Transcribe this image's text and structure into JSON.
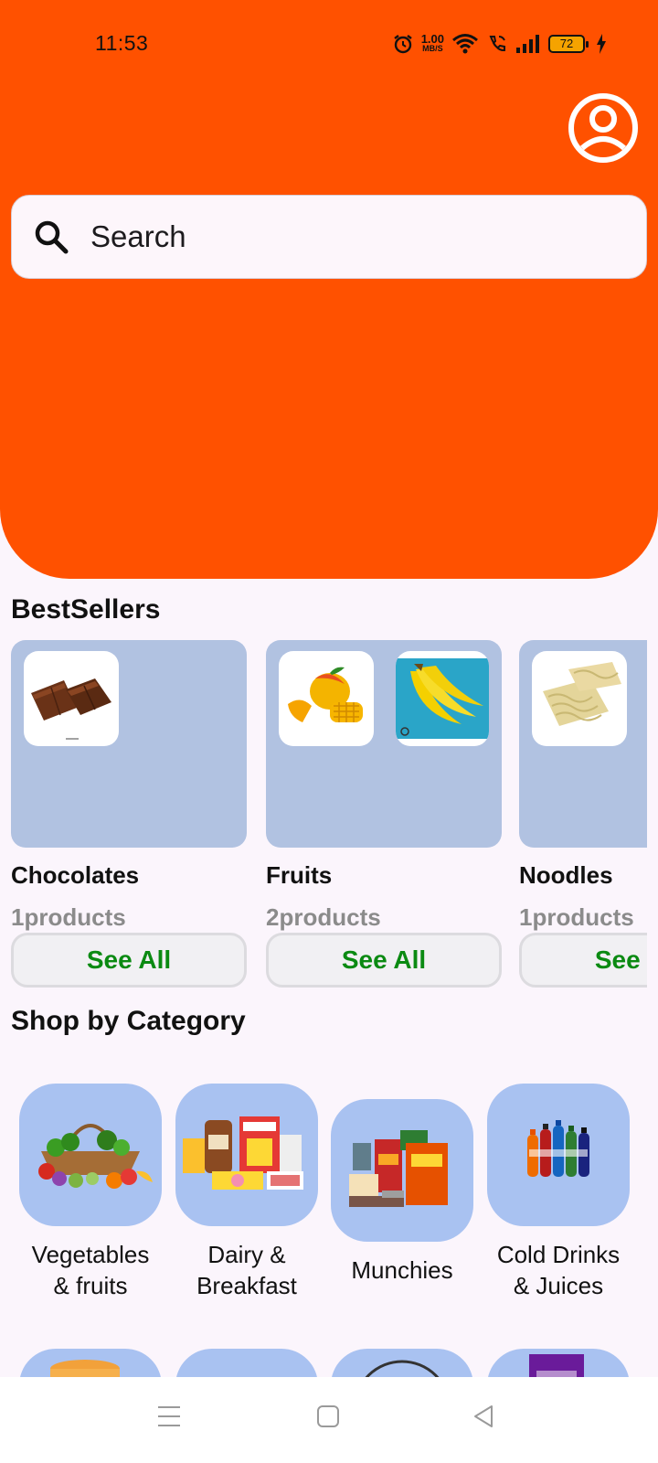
{
  "status_bar": {
    "time": "11:53",
    "net_speed_value": "1.00",
    "net_speed_unit": "MB/S",
    "battery_level": "72",
    "icons": [
      "alarm-icon",
      "wifi-icon",
      "wifi-call-icon",
      "signal-icon",
      "battery-icon",
      "charging-icon"
    ]
  },
  "header": {
    "background_color": "#ff5100",
    "profile_icon": "account-circle-icon"
  },
  "search": {
    "placeholder": "Search",
    "icon": "search-icon"
  },
  "bestsellers": {
    "title": "BestSellers",
    "items": [
      {
        "name": "Chocolates",
        "count": "1products",
        "button": "See All",
        "images": [
          "chocolate-image"
        ]
      },
      {
        "name": "Fruits",
        "count": "2products",
        "button": "See All",
        "images": [
          "mango-image",
          "banana-image"
        ]
      },
      {
        "name": "Noodles",
        "count": "1products",
        "button": "See All",
        "images": [
          "noodles-image"
        ]
      }
    ]
  },
  "categories": {
    "title": "Shop by Category",
    "items": [
      {
        "line1": "Vegetables",
        "line2": "& fruits",
        "image": "vegetables-basket-image"
      },
      {
        "line1": "Dairy &",
        "line2": "Breakfast",
        "image": "dairy-breakfast-image"
      },
      {
        "line1": "Munchies",
        "line2": "",
        "image": "munchies-image"
      },
      {
        "line1": "Cold Drinks",
        "line2": "& Juices",
        "image": "cold-drinks-image"
      }
    ]
  },
  "colors": {
    "accent": "#ff5100",
    "card": "#b1c2e1",
    "category_tile": "#a9c2f1",
    "see_all_text": "#0b8a12"
  },
  "nav": {
    "icons": [
      "menu-icon",
      "home-square-icon",
      "back-triangle-icon"
    ]
  }
}
